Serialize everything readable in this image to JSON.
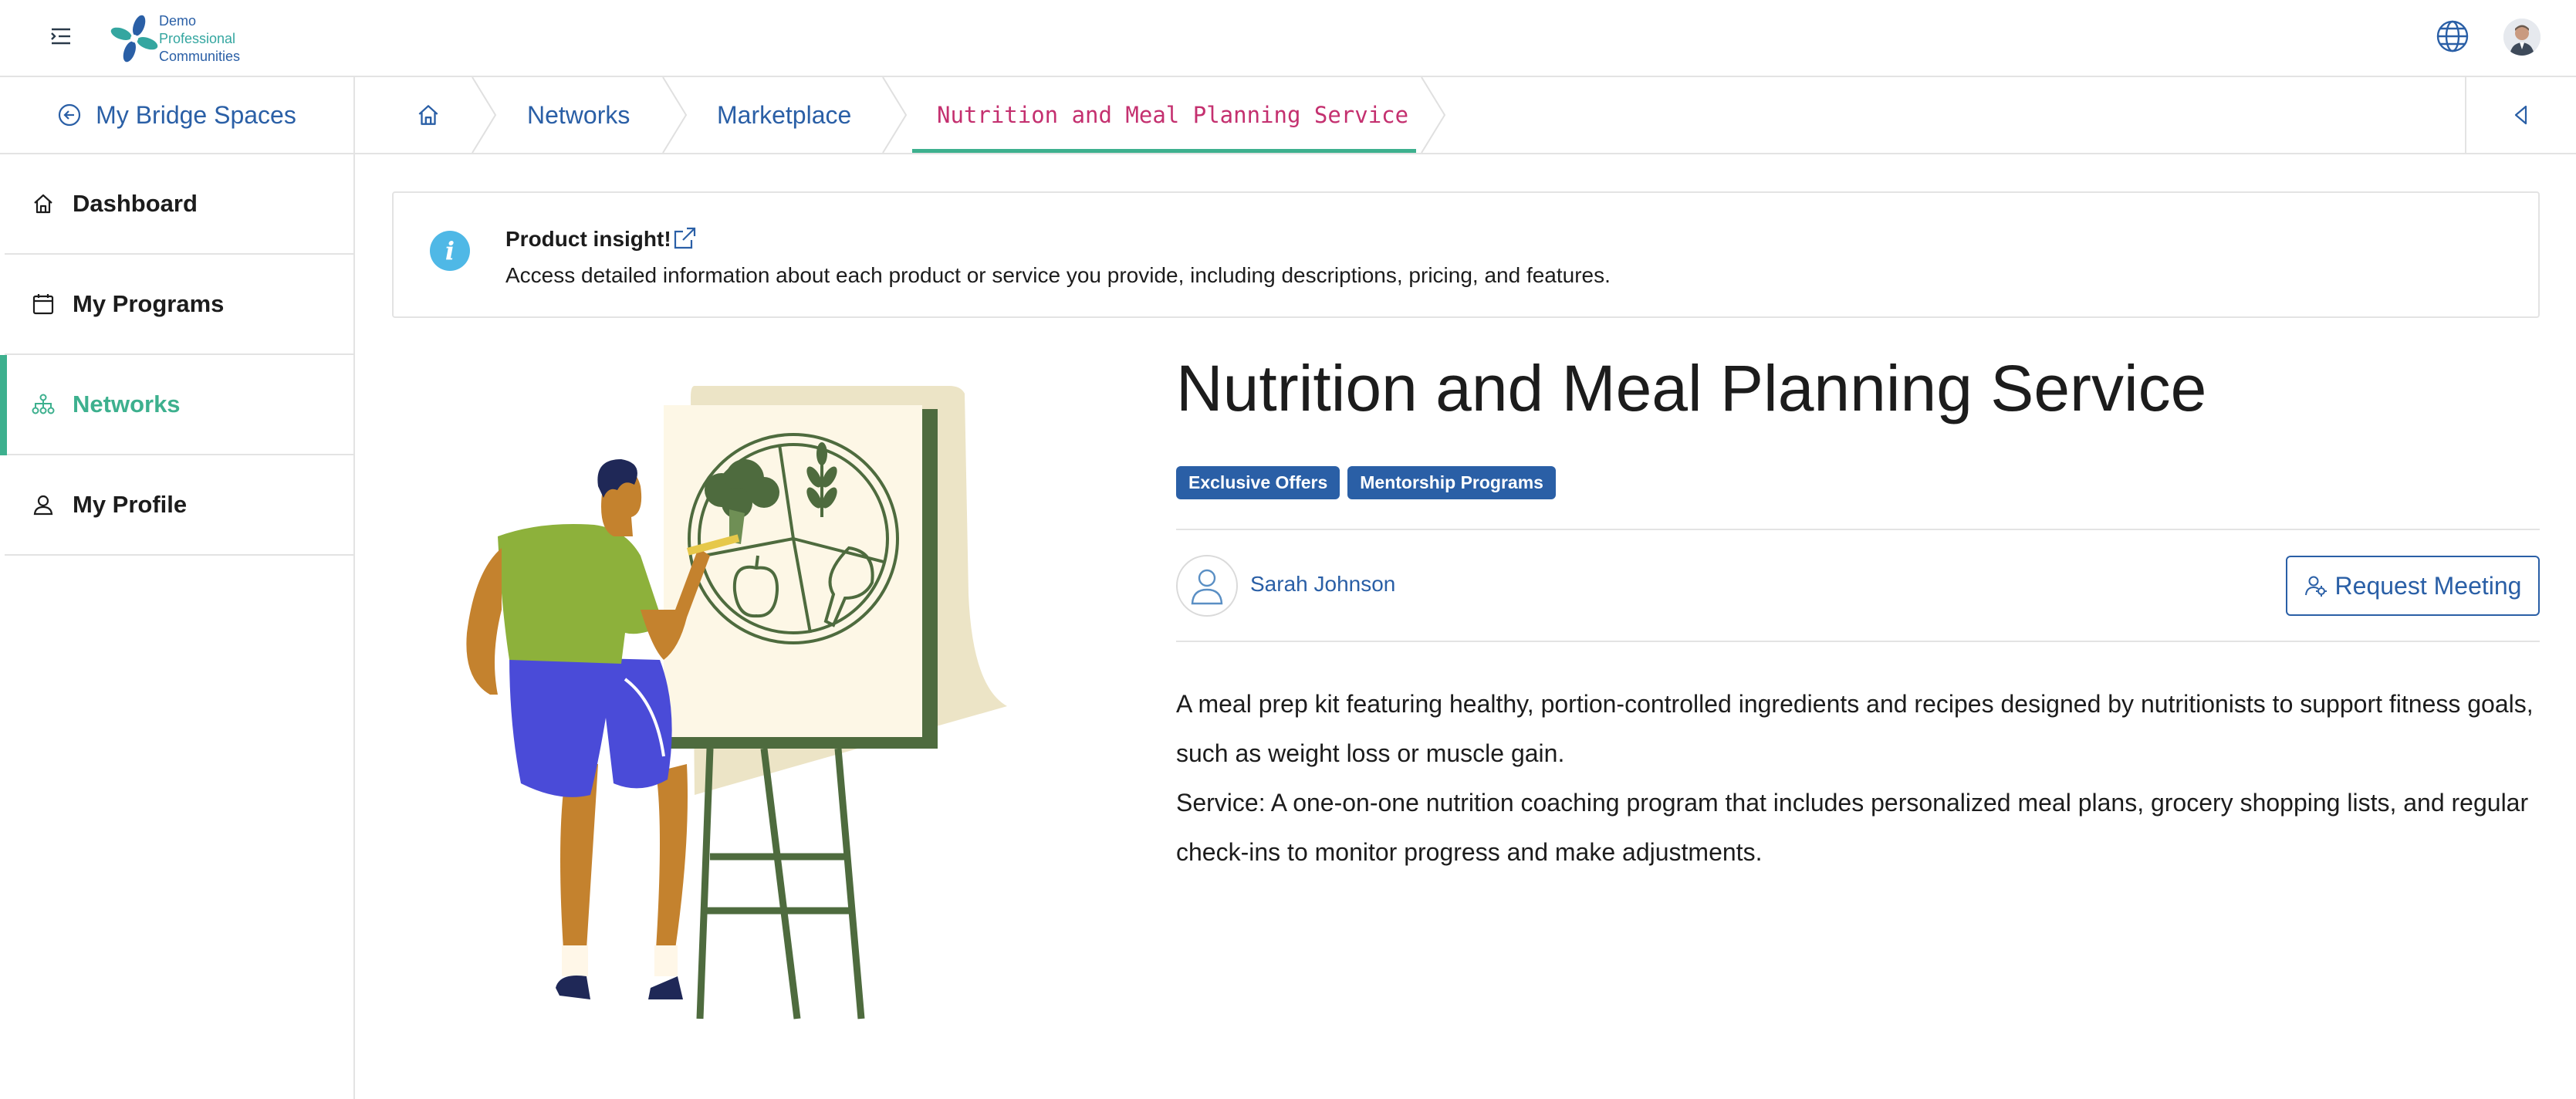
{
  "header": {
    "logo_lines": [
      "Demo",
      "Professional",
      "Communities"
    ]
  },
  "sidebar": {
    "back_label": "My Bridge Spaces",
    "items": [
      {
        "label": "Dashboard"
      },
      {
        "label": "My Programs"
      },
      {
        "label": "Networks"
      },
      {
        "label": "My Profile"
      }
    ],
    "active_item": "Networks"
  },
  "breadcrumb": {
    "items": [
      "Networks",
      "Marketplace",
      "Nutrition and Meal Planning Service"
    ]
  },
  "insight": {
    "title": "Product insight!",
    "text": "Access detailed information about each product or service you provide, including descriptions, pricing, and features."
  },
  "product": {
    "title": "Nutrition and Meal Planning Service",
    "tags": [
      "Exclusive Offers",
      "Mentorship Programs"
    ],
    "owner": "Sarah Johnson",
    "request_label": "Request Meeting",
    "description": [
      "A meal prep kit featuring healthy, portion-controlled ingredients and recipes designed by nutritionists to support fitness goals, such as weight loss or muscle gain.",
      "Service: A one-on-one nutrition coaching program that includes personalized meal plans, grocery shopping lists, and regular check-ins to monitor progress and make adjustments."
    ]
  },
  "colors": {
    "brand_blue": "#2a5fa6",
    "accent_green": "#3db08e",
    "current_crumb": "#c4306f"
  }
}
